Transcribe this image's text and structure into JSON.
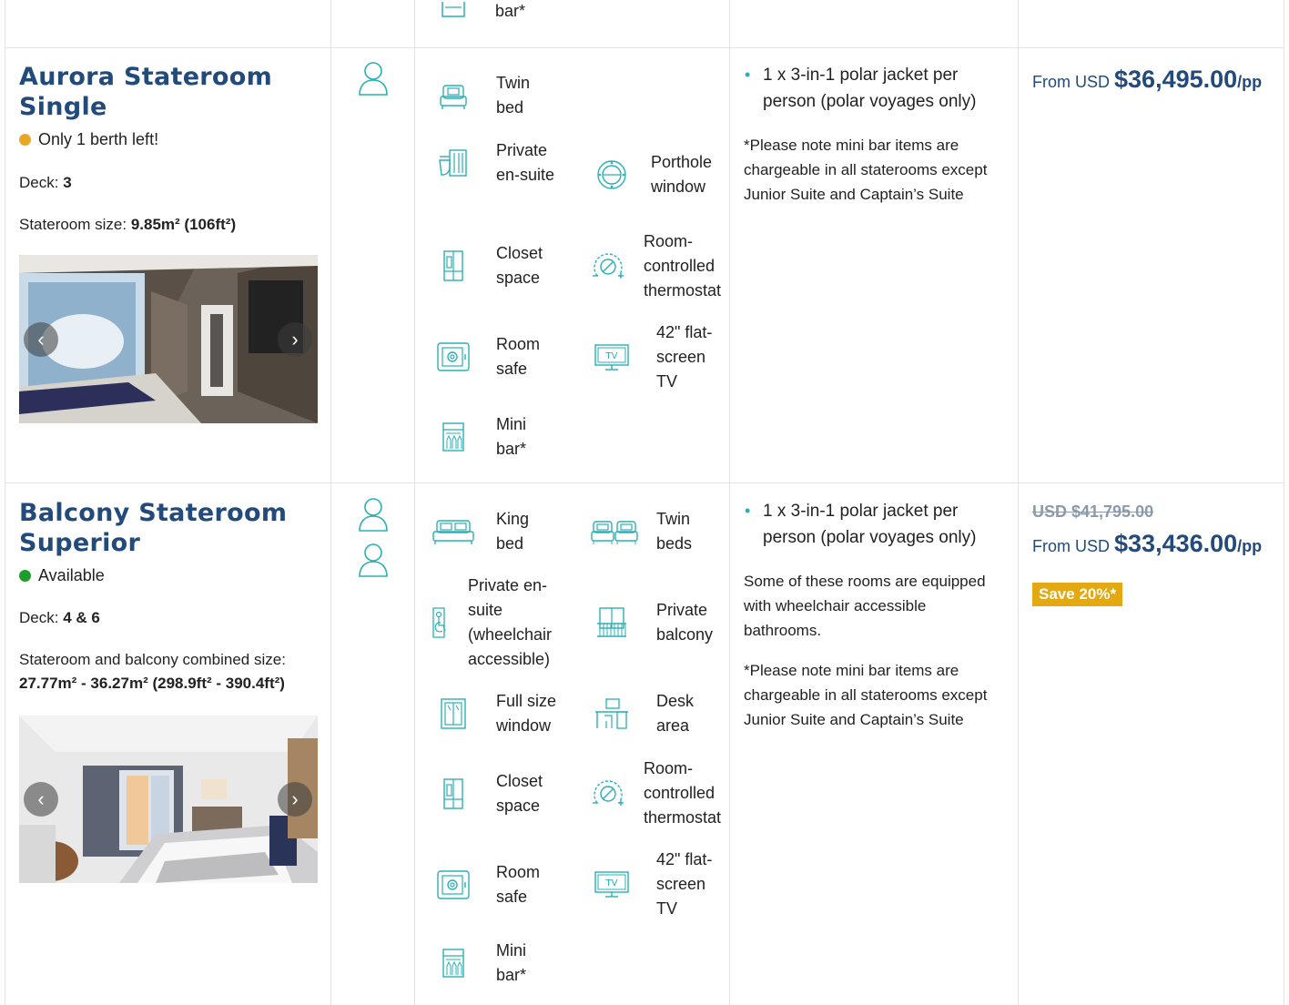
{
  "colors": {
    "accent": "#2ab0b4",
    "title": "#224a7a",
    "status_low": "#e8a826",
    "status_ok": "#1f9d2a",
    "save_badge": "#e3a812"
  },
  "top_fragment": {
    "label": "bar*"
  },
  "rows": [
    {
      "title_line1": "Aurora Stateroom",
      "title_line2": "Single",
      "status": "Only 1 berth left!",
      "deck_label": "Deck:",
      "deck_value": "3",
      "size_label": "Stateroom size:",
      "size_value": "9.85m² (106ft²)",
      "guests": 1,
      "features": [
        {
          "icon": "twin-bed-icon",
          "label": "Twin bed"
        },
        {
          "icon": "private-ensuite-icon",
          "label": "Private en-suite"
        },
        {
          "icon": "porthole-window-icon",
          "label": "Porthole window"
        },
        {
          "icon": "closet-icon",
          "label": "Closet space"
        },
        {
          "icon": "thermostat-icon",
          "label": "Room-controlled thermostat"
        },
        {
          "icon": "room-safe-icon",
          "label": "Room safe"
        },
        {
          "icon": "tv-icon",
          "label": "42\" flat-screen TV"
        },
        {
          "icon": "mini-bar-icon",
          "label": "Mini bar*"
        }
      ],
      "included": "1 x 3-in-1 polar jacket per person (polar voyages only)",
      "notes": [
        "*Please note mini bar items are chargeable in all staterooms except Junior Suite and Captain’s Suite"
      ],
      "price_prefix": "From USD",
      "price": "$36,495.00",
      "price_suffix": "/pp"
    },
    {
      "title_line1": "Balcony Stateroom",
      "title_line2": "Superior",
      "status": "Available",
      "deck_label": "Deck:",
      "deck_value": "4 & 6",
      "size_label": "Stateroom and balcony combined size:",
      "size_value": "27.77m² - 36.27m² (298.9ft² - 390.4ft²)",
      "guests": 2,
      "features": [
        {
          "icon": "king-bed-icon",
          "label": "King bed"
        },
        {
          "icon": "twin-beds-icon",
          "label": "Twin beds"
        },
        {
          "icon": "wheelchair-ensuite-icon",
          "label": "Private en-suite (wheelchair accessible)"
        },
        {
          "icon": "balcony-icon",
          "label": "Private balcony"
        },
        {
          "icon": "window-icon",
          "label": "Full size window"
        },
        {
          "icon": "desk-icon",
          "label": "Desk area"
        },
        {
          "icon": "closet-icon",
          "label": "Closet space"
        },
        {
          "icon": "thermostat-icon",
          "label": "Room-controlled thermostat"
        },
        {
          "icon": "room-safe-icon",
          "label": "Room safe"
        },
        {
          "icon": "tv-icon",
          "label": "42\" flat-screen TV"
        },
        {
          "icon": "mini-bar-icon",
          "label": "Mini bar*"
        }
      ],
      "included": "1 x 3-in-1 polar jacket per person (polar voyages only)",
      "notes": [
        "Some of these rooms are equipped with wheelchair accessible bathrooms.",
        "*Please note mini bar items are chargeable in all staterooms except Junior Suite and Captain’s Suite"
      ],
      "old_price": "USD $41,795.00",
      "price_prefix": "From USD",
      "price": "$33,436.00",
      "price_suffix": "/pp",
      "save_badge": "Save 20%*"
    }
  ]
}
